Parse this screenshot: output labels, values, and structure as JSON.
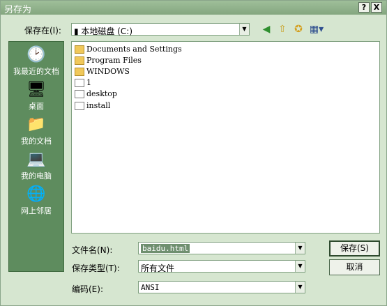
{
  "window": {
    "title": "另存为",
    "help": "?",
    "close": "X"
  },
  "toolbar": {
    "save_in_label": "保存在(I):",
    "location": "本地磁盘 (C:)"
  },
  "places": [
    {
      "label": "我最近的文档",
      "icon": "recent-documents-icon"
    },
    {
      "label": "桌面",
      "icon": "desktop-icon"
    },
    {
      "label": "我的文档",
      "icon": "my-documents-icon"
    },
    {
      "label": "我的电脑",
      "icon": "my-computer-icon"
    },
    {
      "label": "网上邻居",
      "icon": "network-icon"
    }
  ],
  "files": [
    {
      "name": "Documents and Settings",
      "icon": "folder-icon"
    },
    {
      "name": "Program Files",
      "icon": "folder-icon"
    },
    {
      "name": "WINDOWS",
      "icon": "folder-icon"
    },
    {
      "name": "1",
      "icon": "file-icon"
    },
    {
      "name": "desktop",
      "icon": "file-icon"
    },
    {
      "name": "install",
      "icon": "file-icon"
    }
  ],
  "form": {
    "filename_label": "文件名(N):",
    "filename_value": "baidu.html",
    "type_label": "保存类型(T):",
    "type_value": "所有文件",
    "encoding_label": "编码(E):",
    "encoding_value": "ANSI"
  },
  "buttons": {
    "save": "保存(S)",
    "cancel": "取消"
  }
}
